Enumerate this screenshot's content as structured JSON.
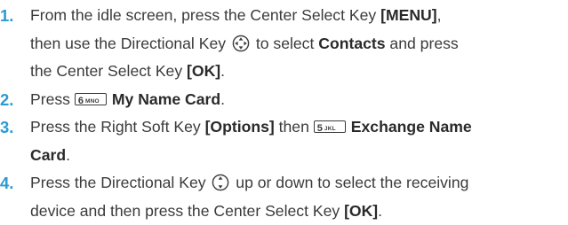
{
  "steps": [
    {
      "num": "1.",
      "l1a": "From the idle screen, press the Center Select Key ",
      "l1b": "[MENU]",
      "l1c": ",",
      "l2a": "then use the Directional Key ",
      "l2b": " to select ",
      "l2c": "Contacts",
      "l2d": " and press",
      "l3a": "the Center Select Key ",
      "l3b": "[OK]",
      "l3c": ".",
      "icon": "directional-key-4way-icon"
    },
    {
      "num": "2.",
      "a": "Press ",
      "key_digit": "6",
      "key_letters": "MNO",
      "b": "My Name Card",
      "c": "."
    },
    {
      "num": "3.",
      "a": "Press the Right Soft Key ",
      "b": "[Options]",
      "c": " then ",
      "key_digit": "5",
      "key_letters": "JKL",
      "d": "Exchange Name",
      "e": "Card",
      "f": "."
    },
    {
      "num": "4.",
      "l1a": "Press the Directional Key ",
      "l1b": " up or down to select the receiving",
      "l2a": "device and then press the Center Select Key ",
      "l2b": "[OK]",
      "l2c": ".",
      "icon": "directional-key-updown-icon"
    }
  ],
  "colors": {
    "number": "#2b9ad5",
    "text": "#3a3a3a"
  }
}
